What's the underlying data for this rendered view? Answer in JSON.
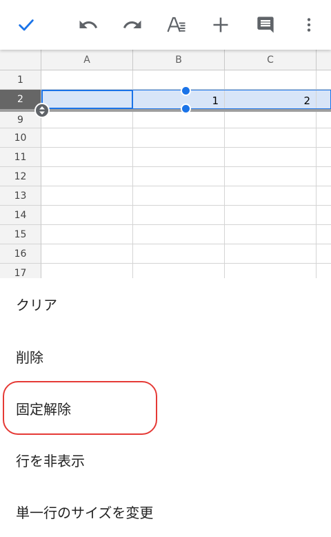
{
  "toolbar": {
    "icons": [
      "check-icon",
      "undo-icon",
      "redo-icon",
      "text-format-icon",
      "add-icon",
      "comment-icon",
      "more-vert-icon"
    ],
    "accent": "#1a73e8"
  },
  "sheet": {
    "columns": [
      "A",
      "B",
      "C"
    ],
    "rows": [
      "1",
      "2",
      "9",
      "10",
      "11",
      "12",
      "13",
      "14",
      "15",
      "16",
      "17"
    ],
    "selected_row": "2",
    "row2_values": {
      "A": "",
      "B": "1",
      "C": "2"
    }
  },
  "menu": {
    "items": [
      "クリア",
      "削除",
      "固定解除",
      "行を非表示",
      "単一行のサイズを変更"
    ],
    "highlighted": "固定解除",
    "highlight_color": "#e53935"
  }
}
